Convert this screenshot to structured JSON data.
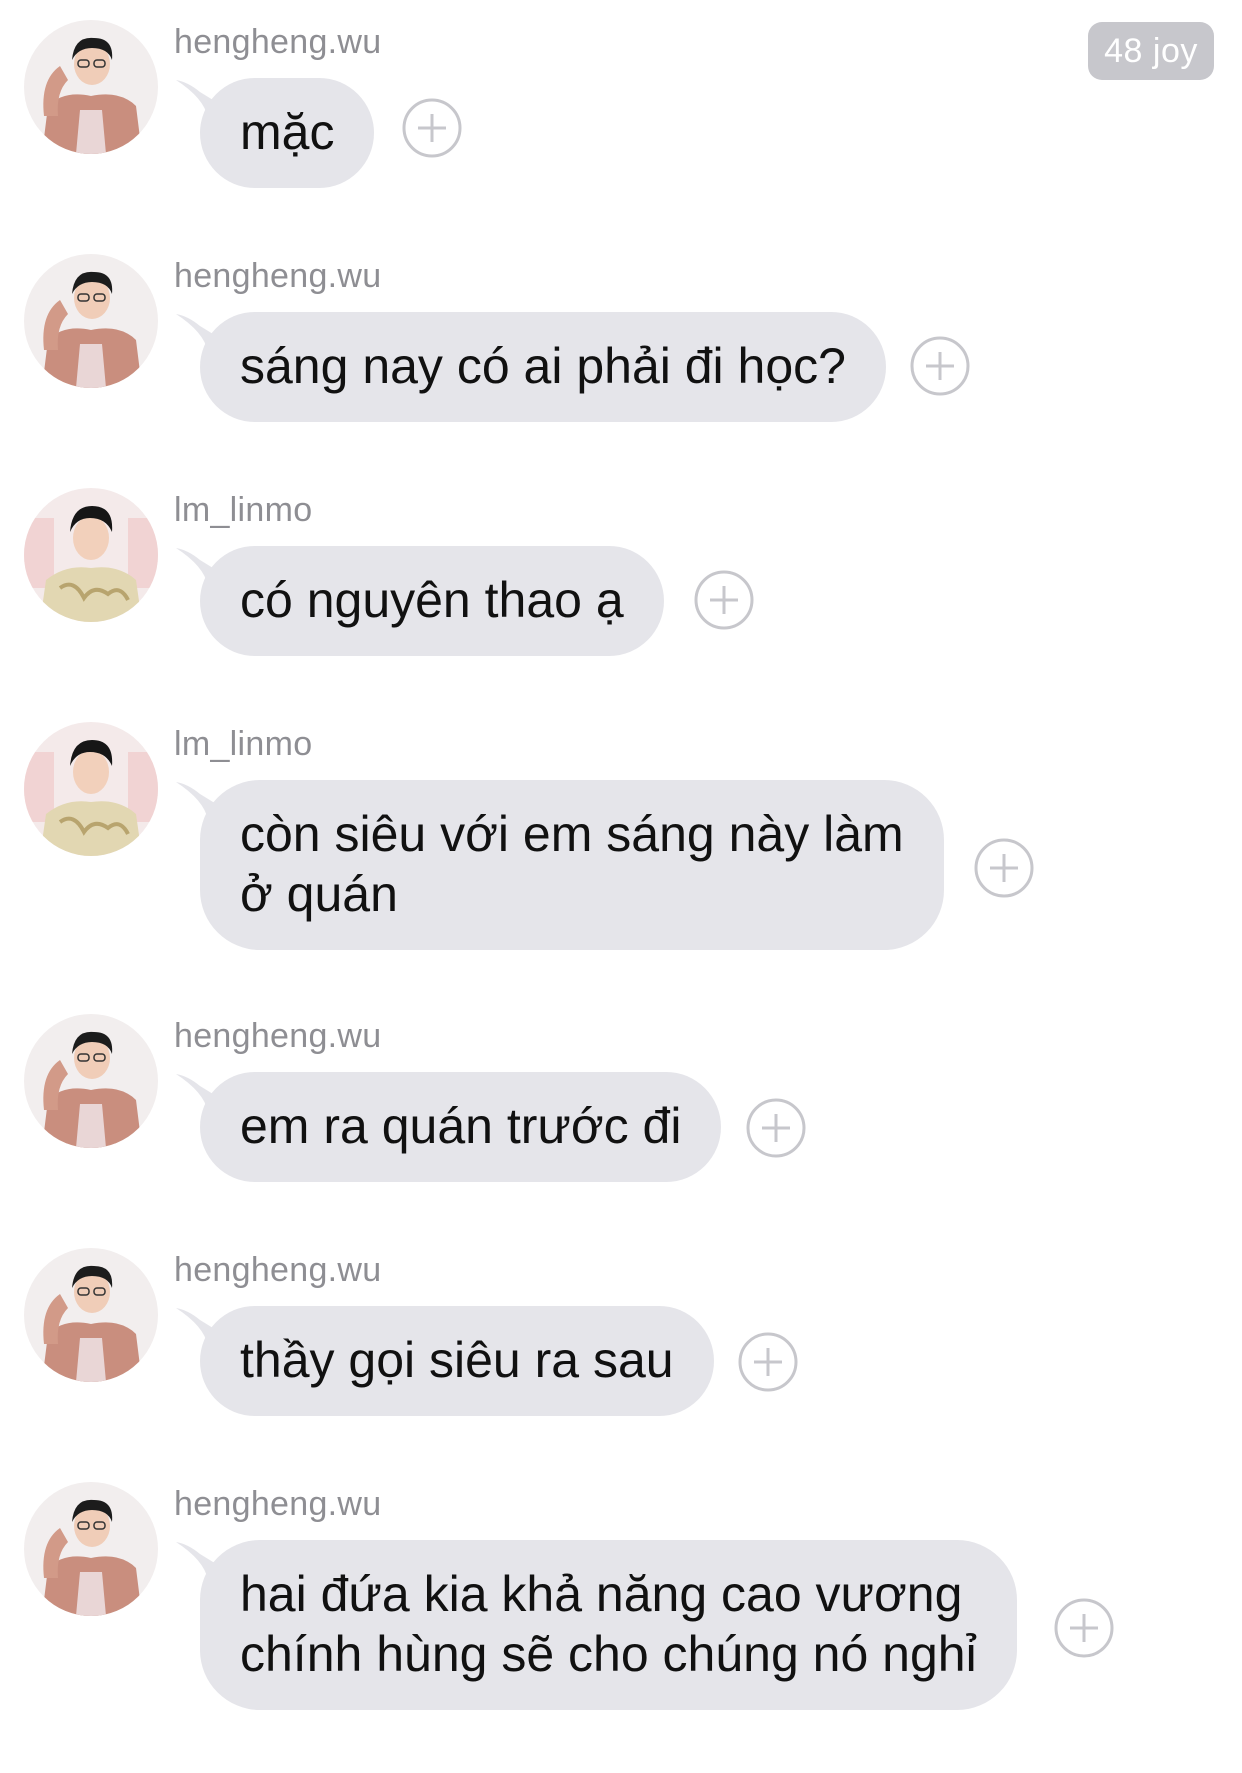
{
  "header": {
    "badge": "48 joy"
  },
  "messages": [
    {
      "username": "hengheng.wu",
      "avatar": "avatar-hengheng",
      "text": "mặc"
    },
    {
      "username": "hengheng.wu",
      "avatar": "avatar-hengheng",
      "text": "sáng nay có ai phải đi học?"
    },
    {
      "username": "lm_linmo",
      "avatar": "avatar-linmo",
      "text": "có nguyên thao ạ"
    },
    {
      "username": "lm_linmo",
      "avatar": "avatar-linmo",
      "text": "còn siêu với em sáng này làm\nở quán"
    },
    {
      "username": "hengheng.wu",
      "avatar": "avatar-hengheng",
      "text": "em ra quán trước đi"
    },
    {
      "username": "hengheng.wu",
      "avatar": "avatar-hengheng",
      "text": "thầy gọi siêu ra sau"
    },
    {
      "username": "hengheng.wu",
      "avatar": "avatar-hengheng",
      "text": "hai đứa kia khả năng cao vương\nchính hùng sẽ cho chúng nó nghỉ"
    }
  ],
  "icons": {
    "reaction": "add-reaction-icon"
  },
  "colors": {
    "bubble": "#e5e5ea",
    "username": "#8e8e93",
    "badge": "#c7c7cc",
    "plus": "#c7c7cc"
  }
}
